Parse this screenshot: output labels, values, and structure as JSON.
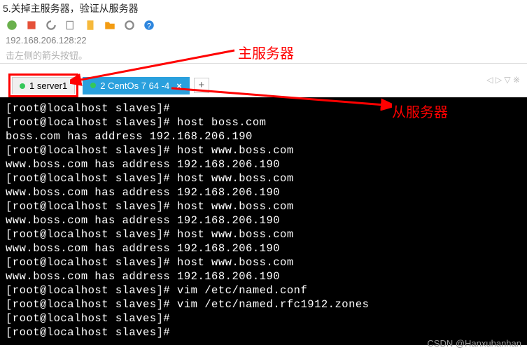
{
  "caption": "5.关掉主服务器，验证从服务器",
  "toolbar": {
    "address": "192.168.206.128:22",
    "hint": "击左侧的箭头按钮。"
  },
  "labels": {
    "master": "主服务器",
    "slave": "从服务器"
  },
  "tabs": {
    "tab1": {
      "text": "1 server1",
      "dot": "#34c759"
    },
    "tab2": {
      "text": "2 CentOs 7 64 -4",
      "dot": "#34c759"
    },
    "add": "+"
  },
  "nav_icons": "◁ ▷ ▽ ※",
  "terminal_lines": [
    "[root@localhost slaves]#",
    "[root@localhost slaves]# host boss.com",
    "boss.com has address 192.168.206.190",
    "[root@localhost slaves]# host www.boss.com",
    "www.boss.com has address 192.168.206.190",
    "[root@localhost slaves]# host www.boss.com",
    "www.boss.com has address 192.168.206.190",
    "[root@localhost slaves]# host www.boss.com",
    "www.boss.com has address 192.168.206.190",
    "[root@localhost slaves]# host www.boss.com",
    "www.boss.com has address 192.168.206.190",
    "[root@localhost slaves]# host www.boss.com",
    "www.boss.com has address 192.168.206.190",
    "[root@localhost slaves]# vim /etc/named.conf",
    "[root@localhost slaves]# vim /etc/named.rfc1912.zones",
    "[root@localhost slaves]#",
    "[root@localhost slaves]#"
  ],
  "watermark": "CSDN @Hanxuhanhan",
  "colors": {
    "accent_red": "#ff0000",
    "tab_blue": "#2aa0dd"
  }
}
